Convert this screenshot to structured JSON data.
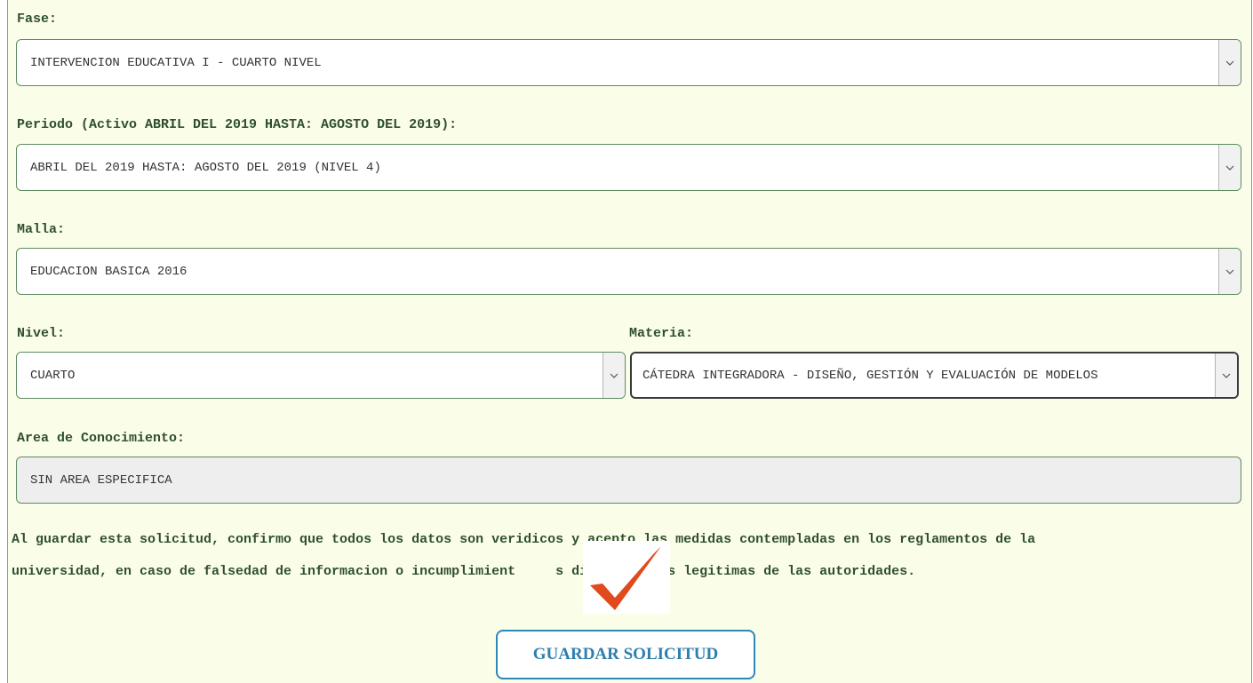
{
  "form": {
    "fase": {
      "label": "Fase:",
      "value": "INTERVENCION EDUCATIVA I - CUARTO NIVEL"
    },
    "periodo": {
      "label": "Periodo (Activo ABRIL DEL 2019 HASTA: AGOSTO DEL 2019):",
      "value": "ABRIL DEL 2019 HASTA: AGOSTO DEL 2019 (NIVEL 4)"
    },
    "malla": {
      "label": "Malla:",
      "value": "EDUCACION BASICA 2016"
    },
    "nivel": {
      "label": "Nivel:",
      "value": "CUARTO"
    },
    "materia": {
      "label": "Materia:",
      "value": "CÁTEDRA INTEGRADORA - DISEÑO, GESTIÓN Y EVALUACIÓN DE MODELOS"
    },
    "area": {
      "label": "Area de Conocimiento:",
      "value": "SIN AREA ESPECIFICA"
    }
  },
  "notice": {
    "line1": "Al guardar esta solicitud, confirmo que todos los datos son veridicos y acepto las medidas contempladas en los reglamentos de la",
    "line2": "universidad, en caso de falsedad de informacion o incumplimient     s disposiciones legitimas de las autoridades."
  },
  "actions": {
    "save_label": "GUARDAR SOLICITUD"
  },
  "icons": {
    "dropdown": "chevron-down-icon",
    "annotation": "checkmark-icon"
  },
  "colors": {
    "panel_background": "#fafde8",
    "label_text": "#2f4f2f",
    "button_accent": "#2b88b8",
    "checkmark": "#e04a1c"
  }
}
